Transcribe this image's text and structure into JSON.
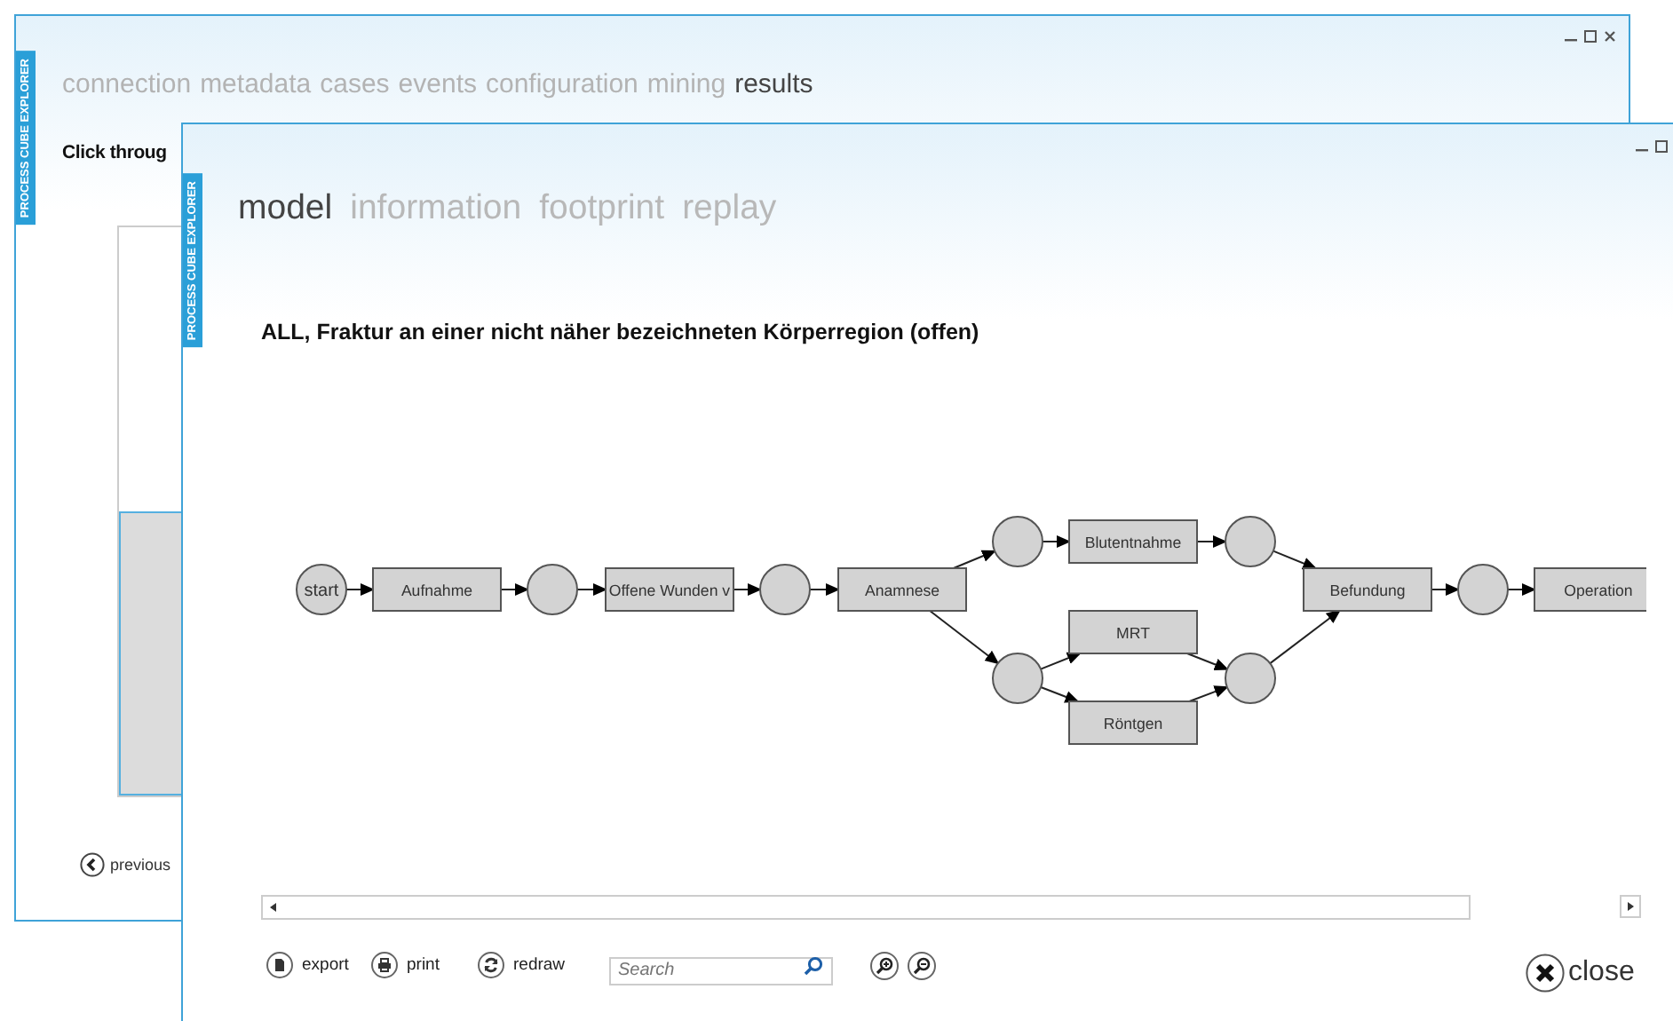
{
  "back_window": {
    "app_label": "PROCESS CUBE EXPLORER",
    "tabs": [
      {
        "label": "connection",
        "selected": false
      },
      {
        "label": "metadata",
        "selected": false
      },
      {
        "label": "cases",
        "selected": false
      },
      {
        "label": "events",
        "selected": false
      },
      {
        "label": "configuration",
        "selected": false
      },
      {
        "label": "mining",
        "selected": false
      },
      {
        "label": "results",
        "selected": true
      }
    ],
    "heading": "Click throug",
    "previous_button": "previous"
  },
  "front_window": {
    "app_label": "PROCESS CUBE EXPLORER",
    "tabs": [
      {
        "label": "model",
        "selected": true
      },
      {
        "label": "information",
        "selected": false
      },
      {
        "label": "footprint",
        "selected": false
      },
      {
        "label": "replay",
        "selected": false
      }
    ],
    "title": "ALL, Fraktur an einer nicht näher bezeichneten Körperregion (offen)",
    "diagram": {
      "nodes": [
        {
          "kind": "place",
          "label": "start"
        },
        {
          "kind": "transition",
          "label": "Aufnahme"
        },
        {
          "kind": "place"
        },
        {
          "kind": "transition",
          "label": "Offene Wunden v"
        },
        {
          "kind": "place"
        },
        {
          "kind": "transition",
          "label": "Anamnese"
        },
        {
          "kind": "place"
        },
        {
          "kind": "transition",
          "label": "Blutentnahme"
        },
        {
          "kind": "place"
        },
        {
          "kind": "place"
        },
        {
          "kind": "transition",
          "label": "MRT"
        },
        {
          "kind": "transition",
          "label": "Röntgen"
        },
        {
          "kind": "place"
        },
        {
          "kind": "transition",
          "label": "Befundung"
        },
        {
          "kind": "place"
        },
        {
          "kind": "transition",
          "label": "Operation"
        }
      ]
    },
    "toolbar": {
      "buttons": [
        {
          "kind": "export",
          "label": "export"
        },
        {
          "kind": "print",
          "label": "print"
        },
        {
          "kind": "redraw",
          "label": "redraw"
        }
      ],
      "search": {
        "placeholder": "Search"
      }
    },
    "close_button": "close"
  }
}
